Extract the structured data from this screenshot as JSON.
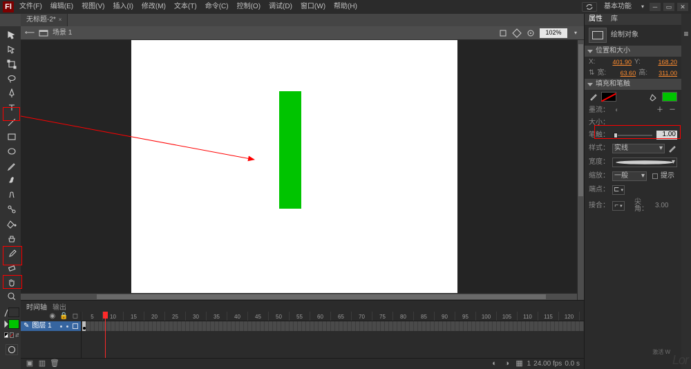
{
  "app": {
    "logo": "Fl"
  },
  "menu": [
    "文件(F)",
    "编辑(E)",
    "视图(V)",
    "插入(I)",
    "修改(M)",
    "文本(T)",
    "命令(C)",
    "控制(O)",
    "调试(D)",
    "窗口(W)",
    "帮助(H)"
  ],
  "titlebar": {
    "workspace_label": "基本功能"
  },
  "doc": {
    "tab_title": "无标题-2*",
    "tab_close": "×"
  },
  "editbar": {
    "back_icon": "⟵",
    "scene_prefix": "场景",
    "scene_number": "1",
    "zoom_value": "102%"
  },
  "tools": {
    "stroke_swatch": "#000000",
    "fill_swatch": "#00c400"
  },
  "stage": {
    "rect_fill": "#00c400"
  },
  "timeline": {
    "tabs": [
      "时间轴",
      "输出"
    ],
    "layer_prefix": "图层",
    "layer_number": "1",
    "ruler_step": 5,
    "ruler_max": 155,
    "footer": {
      "frame": "1",
      "fps": "24.00 fps",
      "time": "0.0 s"
    }
  },
  "panel": {
    "tabs": [
      "属性",
      "库"
    ],
    "object_type": "绘制对象",
    "section_pos": "位置和大小",
    "pos_x_label": "X:",
    "pos_x": "401.90",
    "pos_y_label": "Y:",
    "pos_y": "168.20",
    "w_label": "宽:",
    "w": "63.60",
    "h_label": "高:",
    "h": "311.00",
    "section_fill_stroke": "填充和笔触",
    "stroke_row_label": "笔触：",
    "stroke_value": "1.00",
    "style_label": "样式：",
    "style_value": "实线",
    "width_label": "宽度：",
    "scale_label": "缩放：",
    "scale_value": "一般",
    "hint_label": "提示",
    "cap_label": "端点：",
    "join_label": "接合：",
    "miter_label": "尖角：",
    "miter_value": "3.00",
    "size_label": "大小：",
    "flow_label": "墨流："
  },
  "ghost": {
    "logo": "Lor",
    "hint": "激活 W"
  }
}
